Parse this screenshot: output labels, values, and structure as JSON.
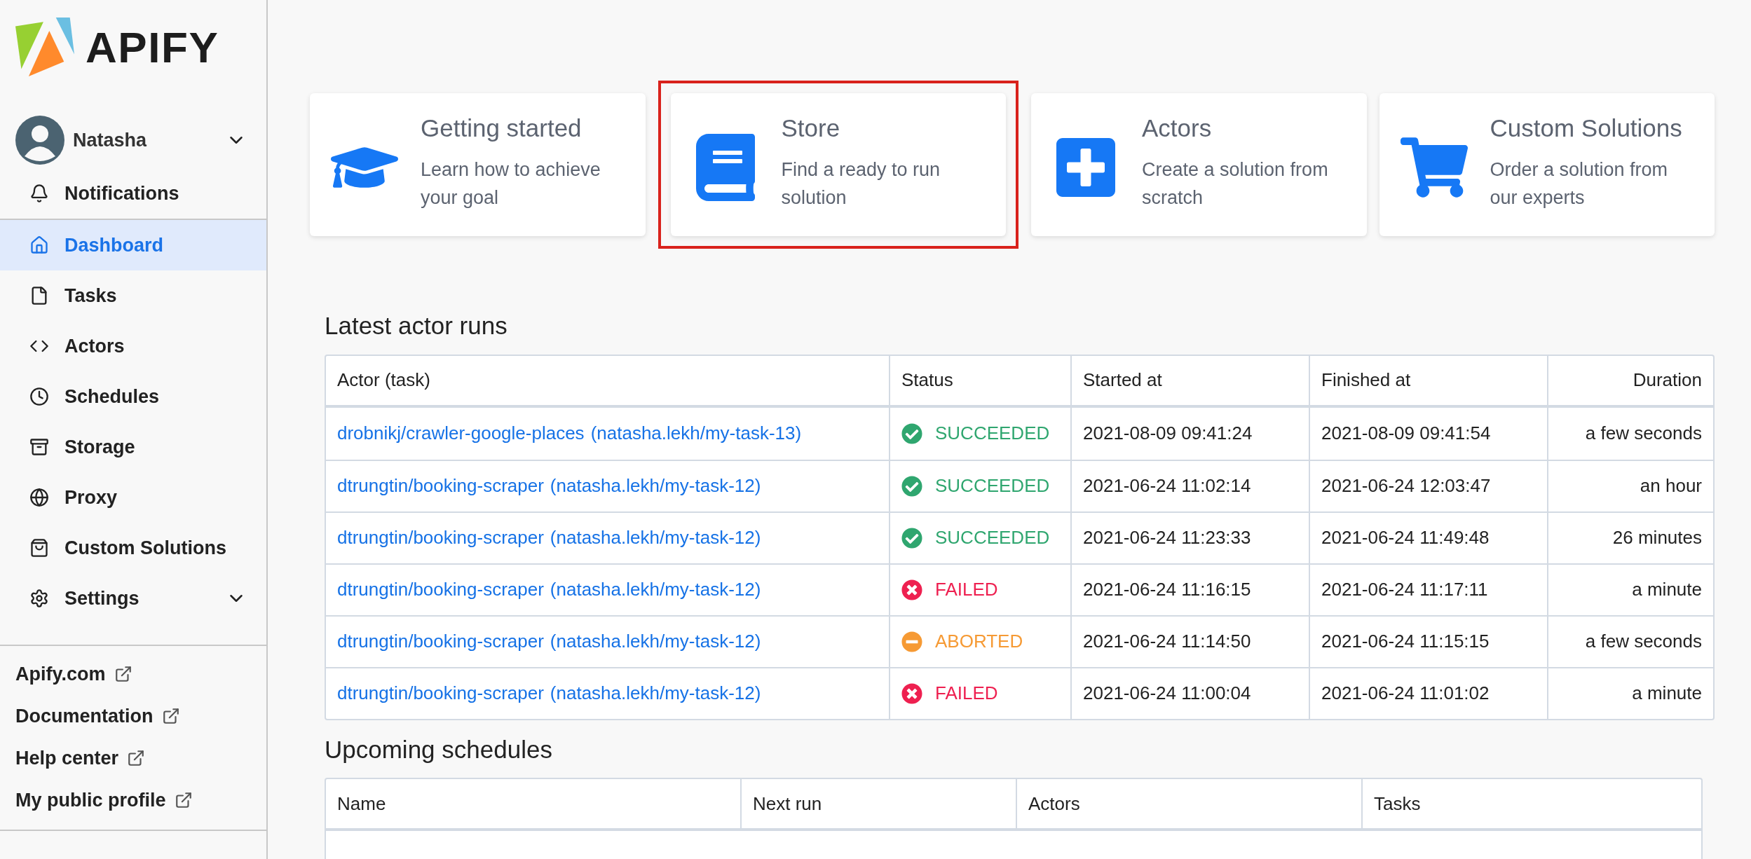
{
  "brand": {
    "name": "APIFY"
  },
  "user": {
    "name": "Natasha"
  },
  "sidebar": {
    "items": [
      {
        "label": "Notifications",
        "kind": "bell",
        "selected": false
      },
      {
        "label": "Dashboard",
        "kind": "home",
        "selected": true
      },
      {
        "label": "Tasks",
        "kind": "file",
        "selected": false
      },
      {
        "label": "Actors",
        "kind": "code",
        "selected": false
      },
      {
        "label": "Schedules",
        "kind": "clock",
        "selected": false
      },
      {
        "label": "Storage",
        "kind": "archive",
        "selected": false
      },
      {
        "label": "Proxy",
        "kind": "globe",
        "selected": false
      },
      {
        "label": "Custom Solutions",
        "kind": "bag",
        "selected": false
      },
      {
        "label": "Settings",
        "kind": "gear",
        "selected": false,
        "submenu": true
      }
    ],
    "links": [
      "Apify.com",
      "Documentation",
      "Help center",
      "My public profile"
    ]
  },
  "cards": [
    {
      "title": "Getting started",
      "description": "Learn how to achieve your goal",
      "kind": "cap",
      "highlighted": false
    },
    {
      "title": "Store",
      "description": "Find a ready to run solution",
      "kind": "book",
      "highlighted": true
    },
    {
      "title": "Actors",
      "description": "Create a solution from scratch",
      "kind": "plus",
      "highlighted": false
    },
    {
      "title": "Custom Solutions",
      "description": "Order a solution from our experts",
      "kind": "cart",
      "highlighted": false
    }
  ],
  "runs": {
    "title": "Latest actor runs",
    "columns": [
      "Actor (task)",
      "Status",
      "Started at",
      "Finished at",
      "Duration"
    ],
    "rows": [
      {
        "actor": "drobnikj/crawler-google-places",
        "task": "(natasha.lekh/my-task-13)",
        "status": "SUCCEEDED",
        "kind": "succeeded",
        "started": "2021-08-09 09:41:24",
        "finished": "2021-08-09 09:41:54",
        "duration": "a few seconds"
      },
      {
        "actor": "dtrungtin/booking-scraper",
        "task": "(natasha.lekh/my-task-12)",
        "status": "SUCCEEDED",
        "kind": "succeeded",
        "started": "2021-06-24 11:02:14",
        "finished": "2021-06-24 12:03:47",
        "duration": "an hour"
      },
      {
        "actor": "dtrungtin/booking-scraper",
        "task": "(natasha.lekh/my-task-12)",
        "status": "SUCCEEDED",
        "kind": "succeeded",
        "started": "2021-06-24 11:23:33",
        "finished": "2021-06-24 11:49:48",
        "duration": "26 minutes"
      },
      {
        "actor": "dtrungtin/booking-scraper",
        "task": "(natasha.lekh/my-task-12)",
        "status": "FAILED",
        "kind": "failed",
        "started": "2021-06-24 11:16:15",
        "finished": "2021-06-24 11:17:11",
        "duration": "a minute"
      },
      {
        "actor": "dtrungtin/booking-scraper",
        "task": "(natasha.lekh/my-task-12)",
        "status": "ABORTED",
        "kind": "aborted",
        "started": "2021-06-24 11:14:50",
        "finished": "2021-06-24 11:15:15",
        "duration": "a few seconds"
      },
      {
        "actor": "dtrungtin/booking-scraper",
        "task": "(natasha.lekh/my-task-12)",
        "status": "FAILED",
        "kind": "failed",
        "started": "2021-06-24 11:00:04",
        "finished": "2021-06-24 11:01:02",
        "duration": "a minute"
      }
    ]
  },
  "schedules": {
    "title": "Upcoming schedules",
    "columns": [
      "Name",
      "Next run",
      "Actors",
      "Tasks"
    ]
  }
}
